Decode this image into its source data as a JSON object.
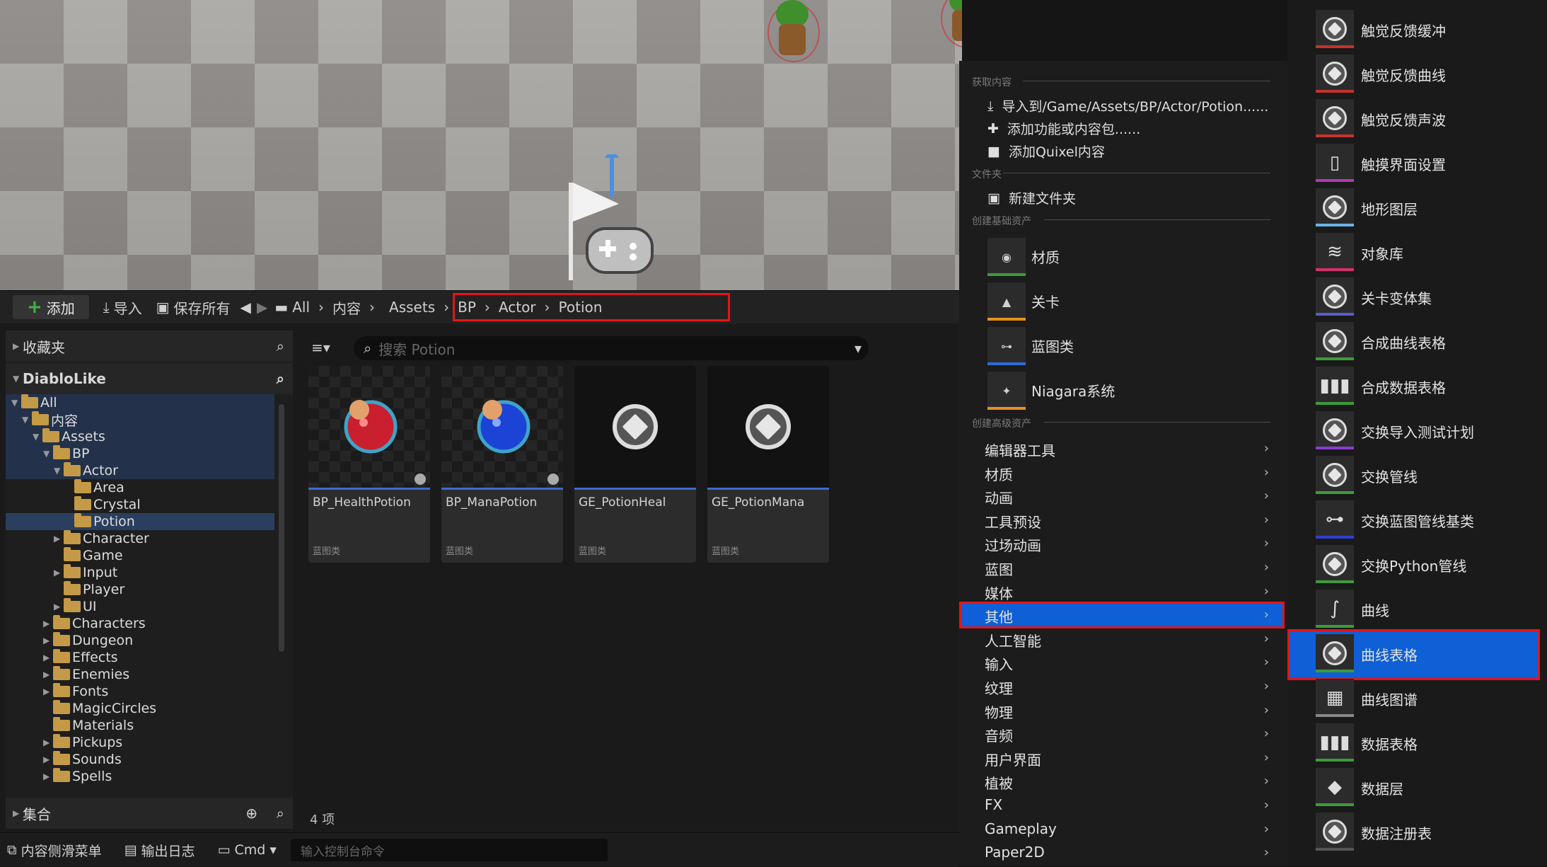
{
  "toolbar": {
    "add": "添加",
    "import": "导入",
    "save_all": "保存所有",
    "breadcrumb": [
      "All",
      "内容",
      "Assets",
      "BP",
      "Actor",
      "Potion"
    ]
  },
  "left_panel": {
    "favorites": "收藏夹",
    "project": "DiabloLike",
    "collections": "集合",
    "tree": [
      {
        "label": "All",
        "depth": 0,
        "expanded": true
      },
      {
        "label": "内容",
        "depth": 1,
        "expanded": true
      },
      {
        "label": "Assets",
        "depth": 2,
        "expanded": true
      },
      {
        "label": "BP",
        "depth": 3,
        "expanded": true
      },
      {
        "label": "Actor",
        "depth": 4,
        "expanded": true
      },
      {
        "label": "Area",
        "depth": 5
      },
      {
        "label": "Crystal",
        "depth": 5
      },
      {
        "label": "Potion",
        "depth": 5,
        "selected": true
      },
      {
        "label": "Character",
        "depth": 4
      },
      {
        "label": "Game",
        "depth": 4
      },
      {
        "label": "Input",
        "depth": 4
      },
      {
        "label": "Player",
        "depth": 4
      },
      {
        "label": "UI",
        "depth": 4
      },
      {
        "label": "Characters",
        "depth": 3
      },
      {
        "label": "Dungeon",
        "depth": 3
      },
      {
        "label": "Effects",
        "depth": 3
      },
      {
        "label": "Enemies",
        "depth": 3
      },
      {
        "label": "Fonts",
        "depth": 3
      },
      {
        "label": "MagicCircles",
        "depth": 3
      },
      {
        "label": "Materials",
        "depth": 3
      },
      {
        "label": "Pickups",
        "depth": 3
      },
      {
        "label": "Sounds",
        "depth": 3
      },
      {
        "label": "Spells",
        "depth": 3
      }
    ]
  },
  "assets": {
    "search_placeholder": "搜索 Potion",
    "items": [
      {
        "name": "BP_HealthPotion",
        "type": "蓝图类",
        "icon": "red-potion-icon"
      },
      {
        "name": "BP_ManaPotion",
        "type": "蓝图类",
        "icon": "blue-potion-icon"
      },
      {
        "name": "GE_PotionHeal",
        "type": "蓝图类",
        "icon": "blueprint-cube-icon"
      },
      {
        "name": "GE_PotionMana",
        "type": "蓝图类",
        "icon": "blueprint-cube-icon"
      }
    ],
    "count": "4 项"
  },
  "statusbar": {
    "drawer": "内容侧滑菜单",
    "output_log": "输出日志",
    "cmd": "Cmd",
    "console_placeholder": "输入控制台命令"
  },
  "menu": {
    "groups": {
      "get_content": "获取内容",
      "folder": "文件夹",
      "basic_assets": "创建基础资产",
      "advanced_assets": "创建高级资产"
    },
    "get_content_items": [
      "导入到/Game/Assets/BP/Actor/Potion......",
      "添加功能或内容包......",
      "添加Quixel内容"
    ],
    "new_folder": "新建文件夹",
    "basic_assets": [
      {
        "label": "材质",
        "color": "#3e9a3a"
      },
      {
        "label": "关卡",
        "color": "#e8911b"
      },
      {
        "label": "蓝图类",
        "color": "#2f6bd3"
      },
      {
        "label": "Niagara系统",
        "color": "#e8911b"
      }
    ],
    "advanced_assets": [
      "编辑器工具",
      "材质",
      "动画",
      "工具预设",
      "过场动画",
      "蓝图",
      "媒体",
      "其他",
      "人工智能",
      "输入",
      "纹理",
      "物理",
      "音频",
      "用户界面",
      "植被",
      "FX",
      "Gameplay",
      "Paper2D"
    ],
    "selected_advanced": "其他"
  },
  "submenu": {
    "items": [
      {
        "label": "触觉反馈缓冲",
        "color": "#c4332b"
      },
      {
        "label": "触觉反馈曲线",
        "color": "#c4332b"
      },
      {
        "label": "触觉反馈声波",
        "color": "#c4332b"
      },
      {
        "label": "触摸界面设置",
        "color": "#b03ab0"
      },
      {
        "label": "地形图层",
        "color": "#6bb3e6"
      },
      {
        "label": "对象库",
        "color": "#d6306c"
      },
      {
        "label": "关卡变体集",
        "color": "#5a5acc"
      },
      {
        "label": "合成曲线表格",
        "color": "#3e9a3a"
      },
      {
        "label": "合成数据表格",
        "color": "#3e9a3a"
      },
      {
        "label": "交换导入测试计划",
        "color": "#8a3ad0"
      },
      {
        "label": "交换管线",
        "color": "#3e9a3a"
      },
      {
        "label": "交换蓝图管线基类",
        "color": "#2f3fd0"
      },
      {
        "label": "交换Python管线",
        "color": "#3e9a3a"
      },
      {
        "label": "曲线",
        "color": "#3e9a3a"
      },
      {
        "label": "曲线表格",
        "color": "#3e9a3a"
      },
      {
        "label": "曲线图谱",
        "color": "#888888"
      },
      {
        "label": "数据表格",
        "color": "#3e9a3a"
      },
      {
        "label": "数据层",
        "color": "#3e9a3a"
      },
      {
        "label": "数据注册表",
        "color": "#555555"
      }
    ],
    "selected": "曲线表格"
  }
}
